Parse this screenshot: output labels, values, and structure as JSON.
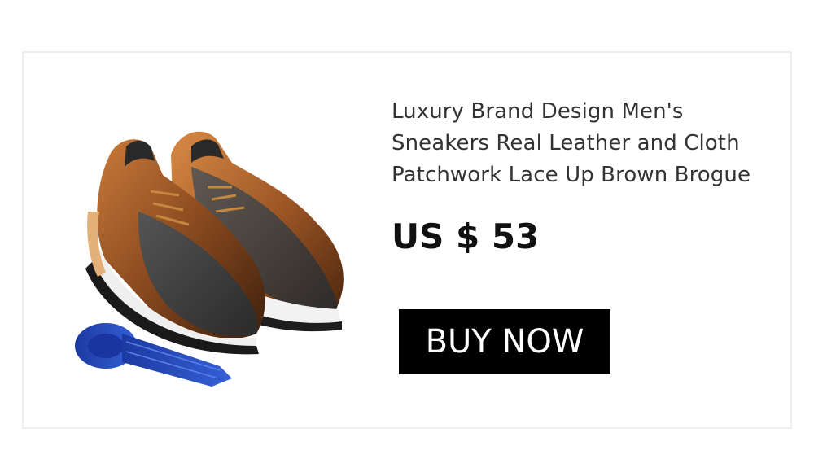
{
  "product": {
    "title": "Luxury Brand Design Men's Sneakers Real Leather and Cloth Patchwork Lace Up Brown Brogue",
    "price": "US $ 53",
    "buy_label": "BUY NOW",
    "image_icon": "shoe-and-tie-photo",
    "colors": {
      "leather": "#8a4a1f",
      "cloth": "#3b3b3b",
      "tie": "#2a4fc4",
      "button": "#000000"
    }
  }
}
